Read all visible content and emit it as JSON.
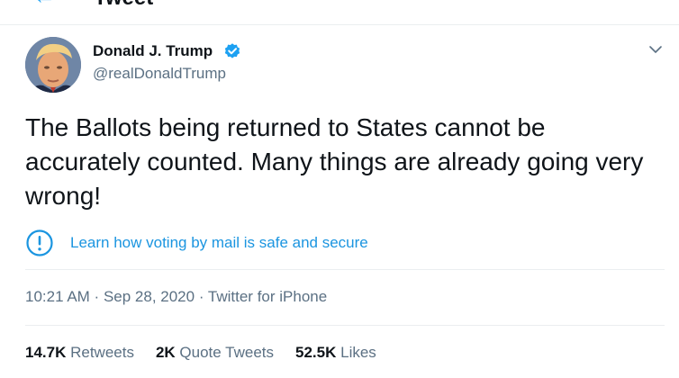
{
  "header": {
    "title": "Tweet",
    "back_icon": "arrow-left-icon"
  },
  "tweet": {
    "author": {
      "name": "Donald J. Trump",
      "handle": "@realDonaldTrump",
      "verified": true,
      "verified_icon": "verified-badge-icon"
    },
    "menu_icon": "chevron-down-icon",
    "text": "The Ballots being returned to States cannot be accurately counted. Many things are already going very wrong!",
    "notice": {
      "icon": "exclamation-circle-icon",
      "label": "Learn how voting by mail is safe and secure"
    },
    "meta": {
      "time": "10:21 AM",
      "separator": " · ",
      "date": "Sep 28, 2020",
      "source": "Twitter for iPhone"
    },
    "stats": {
      "retweets_count": "14.7K",
      "retweets_label": " Retweets",
      "quotes_count": "2K",
      "quotes_label": " Quote Tweets",
      "likes_count": "52.5K",
      "likes_label": " Likes"
    }
  },
  "colors": {
    "accent": "#1da1f2",
    "link": "#1b95e0",
    "secondary_text": "#5b7083",
    "divider": "#ebeef0"
  }
}
